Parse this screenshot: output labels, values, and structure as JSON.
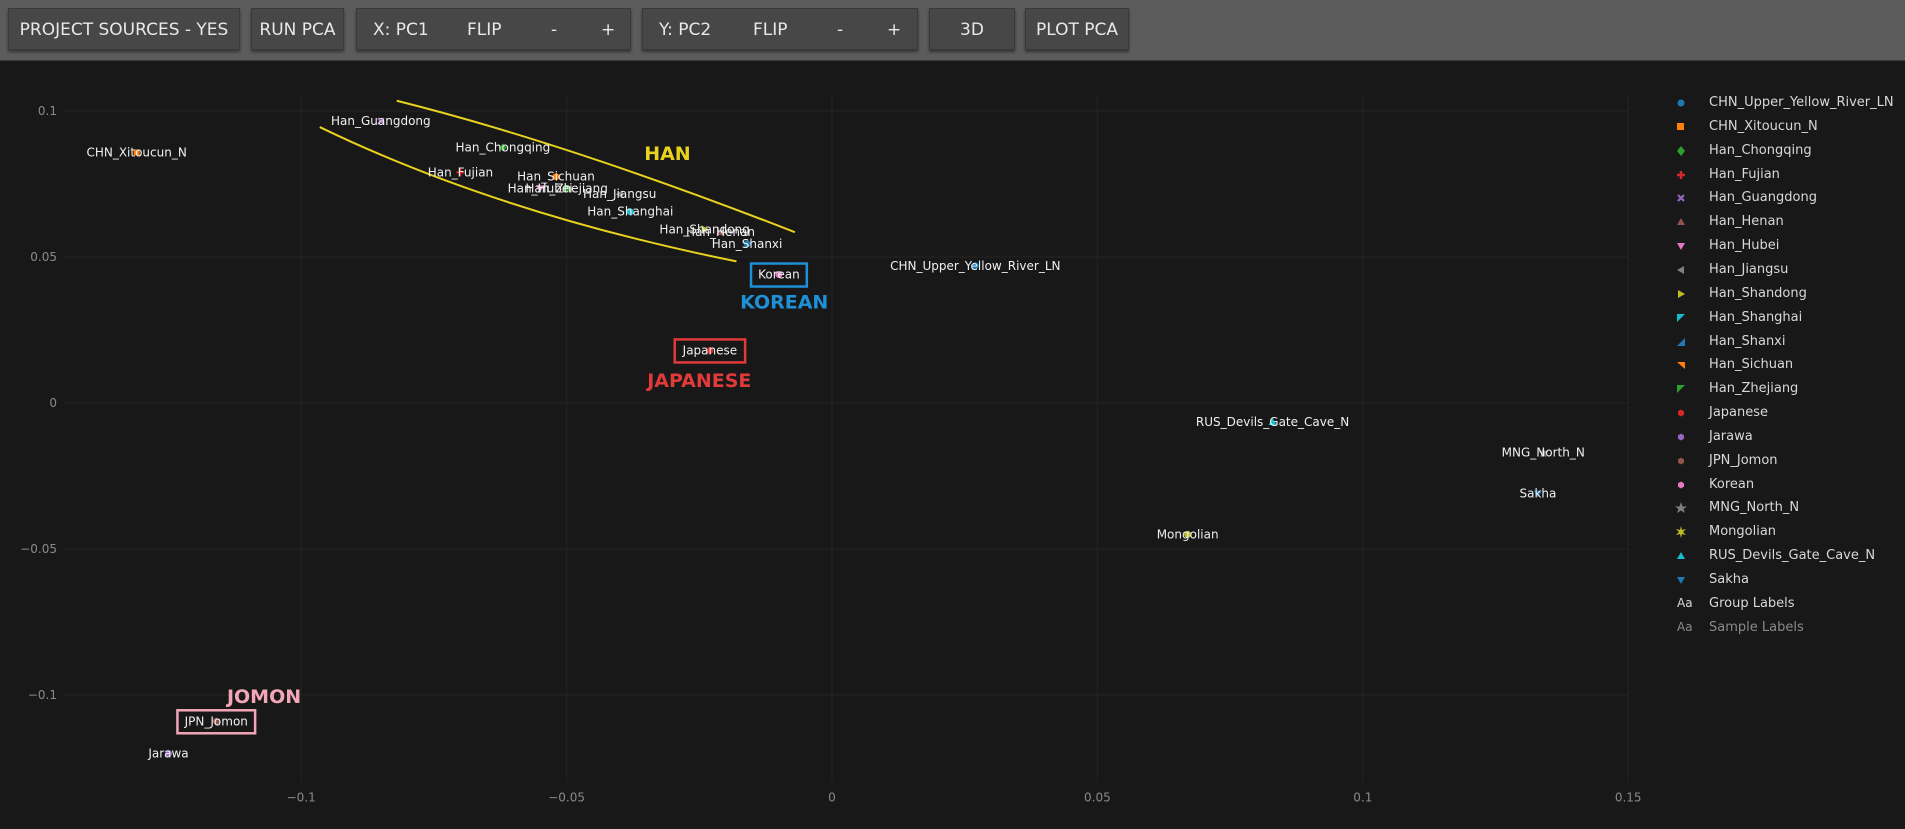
{
  "toolbar": {
    "project_sources": "PROJECT SOURCES - YES",
    "run_pca": "RUN PCA",
    "x_axis": {
      "label": "X: PC1",
      "flip": "FLIP",
      "minus": "-",
      "plus": "+"
    },
    "y_axis": {
      "label": "Y: PC2",
      "flip": "FLIP",
      "minus": "-",
      "plus": "+"
    },
    "three_d": "3D",
    "plot_pca": "PLOT PCA"
  },
  "chart_data": {
    "type": "scatter",
    "xlim": [
      -0.125,
      0.155
    ],
    "ylim": [
      -0.13,
      0.105
    ],
    "x_ticks": [
      -0.1,
      -0.05,
      0,
      0.05,
      0.1,
      0.15
    ],
    "x_tick_labels": [
      "−0.1",
      "−0.05",
      "0",
      "0.05",
      "0.1",
      "0.15"
    ],
    "y_ticks": [
      0.1,
      0.05,
      0,
      -0.05,
      -0.1
    ],
    "y_tick_labels": [
      "0.1",
      "0.05",
      "0",
      "−0.05",
      "−0.1"
    ],
    "grid": true,
    "legend_position": "right",
    "series": [
      {
        "name": "CHN_Upper_Yellow_River_LN",
        "x": [
          0.027
        ],
        "y": [
          0.047
        ],
        "color": "#1f77b4",
        "marker": "circle"
      },
      {
        "name": "CHN_Xitoucun_N",
        "x": [
          -0.131
        ],
        "y": [
          0.0858
        ],
        "color": "#ff7f0e",
        "marker": "square"
      },
      {
        "name": "Han_Chongqing",
        "x": [
          -0.062
        ],
        "y": [
          0.0875
        ],
        "color": "#2ca02c",
        "marker": "diamond"
      },
      {
        "name": "Han_Fujian",
        "x": [
          -0.07
        ],
        "y": [
          0.079
        ],
        "color": "#d62728",
        "marker": "plus"
      },
      {
        "name": "Han_Guangdong",
        "x": [
          -0.085
        ],
        "y": [
          0.0965
        ],
        "color": "#9467bd",
        "marker": "x"
      },
      {
        "name": "Han_Henan",
        "x": [
          -0.021
        ],
        "y": [
          0.0585
        ],
        "color": "#8c564b",
        "marker": "triangle-up"
      },
      {
        "name": "Han_Hubei",
        "x": [
          -0.055
        ],
        "y": [
          0.0735
        ],
        "color": "#e377c2",
        "marker": "triangle-down"
      },
      {
        "name": "Han_Jiangsu",
        "x": [
          -0.04
        ],
        "y": [
          0.0715
        ],
        "color": "#7f7f7f",
        "marker": "triangle-left"
      },
      {
        "name": "Han_Shandong",
        "x": [
          -0.024
        ],
        "y": [
          0.0595
        ],
        "color": "#bcbd22",
        "marker": "triangle-right"
      },
      {
        "name": "Han_Shanghai",
        "x": [
          -0.038
        ],
        "y": [
          0.0655
        ],
        "color": "#17becf",
        "marker": "tri-ul"
      },
      {
        "name": "Han_Shanxi",
        "x": [
          -0.016
        ],
        "y": [
          0.0545
        ],
        "color": "#1f77b4",
        "marker": "tri-ur"
      },
      {
        "name": "Han_Sichuan",
        "x": [
          -0.052
        ],
        "y": [
          0.0775
        ],
        "color": "#ff7f0e",
        "marker": "tri-dr"
      },
      {
        "name": "Han_Zhejiang",
        "x": [
          -0.05
        ],
        "y": [
          0.0735
        ],
        "color": "#2ca02c",
        "marker": "tri-dl"
      },
      {
        "name": "Japanese",
        "x": [
          -0.023
        ],
        "y": [
          0.018
        ],
        "color": "#d62728",
        "marker": "hexagon"
      },
      {
        "name": "Jarawa",
        "x": [
          -0.125
        ],
        "y": [
          -0.12
        ],
        "color": "#9467bd",
        "marker": "hexagon"
      },
      {
        "name": "JPN_Jomon",
        "x": [
          -0.116
        ],
        "y": [
          -0.109
        ],
        "color": "#8c564b",
        "marker": "hexagon"
      },
      {
        "name": "Korean",
        "x": [
          -0.01
        ],
        "y": [
          0.044
        ],
        "color": "#e377c2",
        "marker": "hexagon"
      },
      {
        "name": "MNG_North_N",
        "x": [
          0.134
        ],
        "y": [
          -0.017
        ],
        "color": "#7f7f7f",
        "marker": "star"
      },
      {
        "name": "Mongolian",
        "x": [
          0.067
        ],
        "y": [
          -0.045
        ],
        "color": "#bcbd22",
        "marker": "star-burst"
      },
      {
        "name": "RUS_Devils_Gate_Cave_N",
        "x": [
          0.083
        ],
        "y": [
          -0.0065
        ],
        "color": "#17becf",
        "marker": "triangle-up"
      },
      {
        "name": "Sakha",
        "x": [
          0.133
        ],
        "y": [
          -0.031
        ],
        "color": "#1f77b4",
        "marker": "triangle-down"
      }
    ],
    "point_labels": [
      {
        "text": "CHN_Upper_Yellow_River_LN",
        "x": 0.027,
        "y": 0.047
      },
      {
        "text": "CHN_Xitoucun_N",
        "x": -0.131,
        "y": 0.0858
      },
      {
        "text": "Han_Chongqing",
        "x": -0.062,
        "y": 0.0875
      },
      {
        "text": "Han_Fujian",
        "x": -0.07,
        "y": 0.079
      },
      {
        "text": "Han_Guangdong",
        "x": -0.085,
        "y": 0.0965
      },
      {
        "text": "Han_Henan",
        "x": -0.021,
        "y": 0.0585
      },
      {
        "text": "Han_Hubei",
        "x": -0.055,
        "y": 0.0735
      },
      {
        "text": "Han_Jiangsu",
        "x": -0.04,
        "y": 0.0715
      },
      {
        "text": "Han_Shandong",
        "x": -0.024,
        "y": 0.0595
      },
      {
        "text": "Han_Shanghai",
        "x": -0.038,
        "y": 0.0655
      },
      {
        "text": "Han_Shanxi",
        "x": -0.016,
        "y": 0.0545
      },
      {
        "text": "Han_Sichuan",
        "x": -0.052,
        "y": 0.0775
      },
      {
        "text": "Han_Zhejiang",
        "x": -0.05,
        "y": 0.0735
      },
      {
        "text": "Japanese",
        "x": -0.023,
        "y": 0.018
      },
      {
        "text": "Jarawa",
        "x": -0.125,
        "y": -0.12
      },
      {
        "text": "JPN_Jomon",
        "x": -0.116,
        "y": -0.109
      },
      {
        "text": "Korean",
        "x": -0.01,
        "y": 0.044
      },
      {
        "text": "MNG_North_N",
        "x": 0.134,
        "y": -0.017
      },
      {
        "text": "Mongolian",
        "x": 0.067,
        "y": -0.045
      },
      {
        "text": "RUS_Devils_Gate_Cave_N",
        "x": 0.083,
        "y": -0.0065
      },
      {
        "text": "Sakha",
        "x": 0.133,
        "y": -0.031
      }
    ],
    "annotations": [
      {
        "text": "HAN",
        "color": "#e8d21f",
        "x": -0.031,
        "y": 0.0857
      },
      {
        "text": "KOREAN",
        "color": "#1f8fd6",
        "x": -0.009,
        "y": 0.0348
      },
      {
        "text": "JAPANESE",
        "color": "#e03a3a",
        "x": -0.025,
        "y": 0.0078
      },
      {
        "text": "JOMON",
        "color": "#f2a6b8",
        "x": -0.107,
        "y": -0.1003
      }
    ],
    "boxes": [
      {
        "label": "Korean",
        "color": "#1f8fd6"
      },
      {
        "label": "Japanese",
        "color": "#e03a3a"
      },
      {
        "label": "JPN_Jomon",
        "color": "#f2a6b8"
      }
    ],
    "han_outline_color": "#e8d21f"
  },
  "legend": {
    "group_labels": "Group Labels",
    "sample_labels": "Sample Labels",
    "aa": "Aa"
  }
}
